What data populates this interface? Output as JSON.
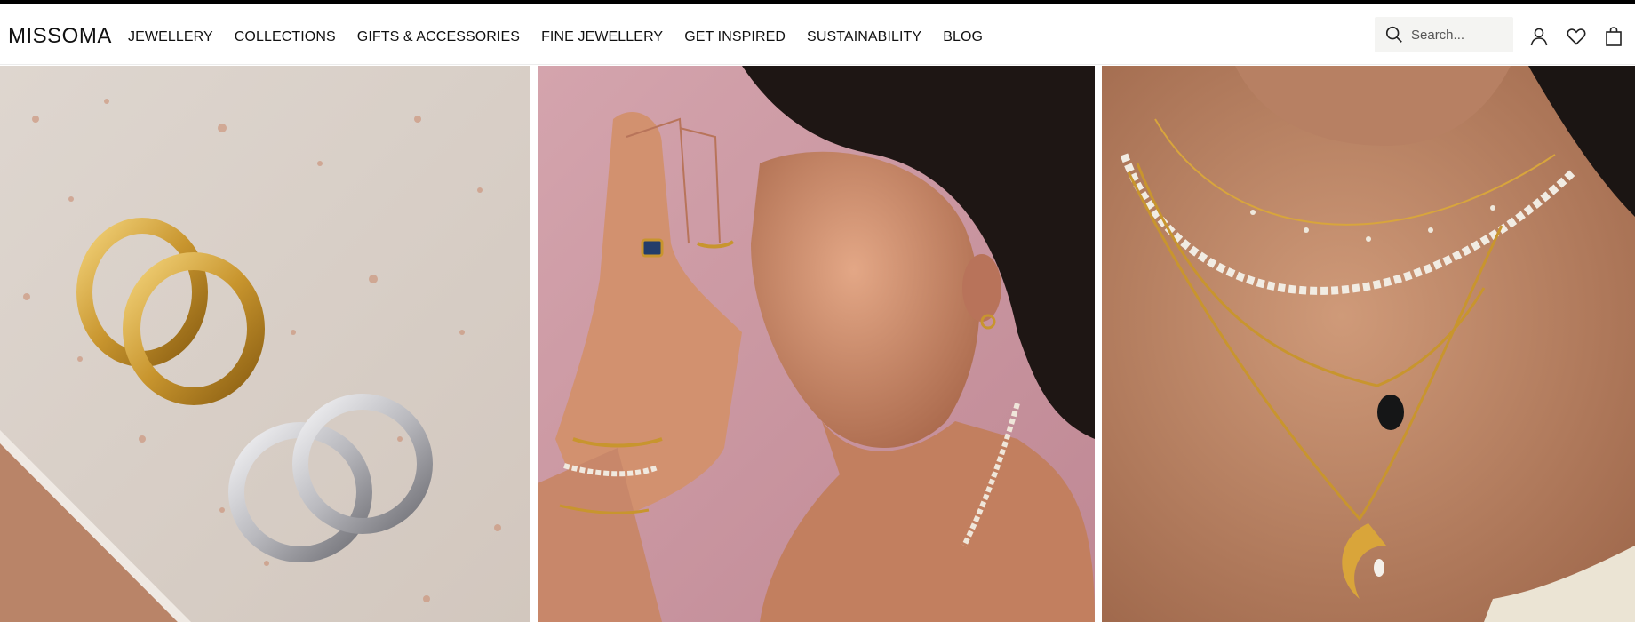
{
  "brand": {
    "logo_text": "MISSOMA"
  },
  "nav": {
    "items": [
      {
        "label": "JEWELLERY"
      },
      {
        "label": "COLLECTIONS"
      },
      {
        "label": "GIFTS & ACCESSORIES"
      },
      {
        "label": "FINE JEWELLERY"
      },
      {
        "label": "GET INSPIRED"
      },
      {
        "label": "SUSTAINABILITY"
      },
      {
        "label": "BLOG"
      }
    ]
  },
  "search": {
    "placeholder": "Search..."
  },
  "header_icons": [
    "search-icon",
    "account-icon",
    "wishlist-heart-icon",
    "shopping-bag-icon"
  ],
  "colors": {
    "topbar": "#000000",
    "text": "#111111",
    "search_bg": "#f4f4f2",
    "panel1_bg": "#d9cec6",
    "panel2_bg": "#c9959f",
    "panel3_bg": "#b07b5c",
    "gold": "#c8952e",
    "silver": "#c9c9cc"
  },
  "hero": {
    "panels": [
      {
        "name": "gold-and-silver-hoop-earrings-image"
      },
      {
        "name": "model-portrait-rings-bracelets-image"
      },
      {
        "name": "layered-necklaces-image"
      }
    ]
  }
}
